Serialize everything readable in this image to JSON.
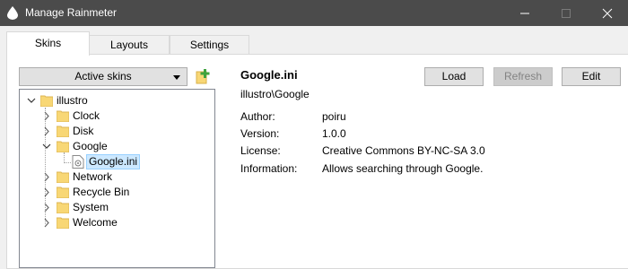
{
  "window": {
    "title": "Manage Rainmeter"
  },
  "tabs": [
    {
      "label": "Skins",
      "active": true
    },
    {
      "label": "Layouts",
      "active": false
    },
    {
      "label": "Settings",
      "active": false
    }
  ],
  "skins_panel": {
    "dropdown_label": "Active skins",
    "tree": {
      "root": "illustro",
      "children": [
        "Clock",
        "Disk",
        "Google",
        "Network",
        "Recycle Bin",
        "System",
        "Welcome"
      ],
      "expanded_child": "Google",
      "expanded_file": "Google.ini"
    }
  },
  "details": {
    "name": "Google.ini",
    "path": "illustro\\Google",
    "buttons": {
      "load": "Load",
      "refresh": "Refresh",
      "edit": "Edit"
    },
    "fields": [
      {
        "label": "Author:",
        "value": "poiru"
      },
      {
        "label": "Version:",
        "value": "1.0.0"
      },
      {
        "label": "License:",
        "value": "Creative Commons BY-NC-SA 3.0"
      },
      {
        "label": "Information:",
        "value": "Allows searching through Google."
      }
    ]
  },
  "colors": {
    "titlebar": "#4b4b4b",
    "selection": "#cce8ff",
    "folder": "#f8d775",
    "add_icon": "#3fa33f"
  }
}
